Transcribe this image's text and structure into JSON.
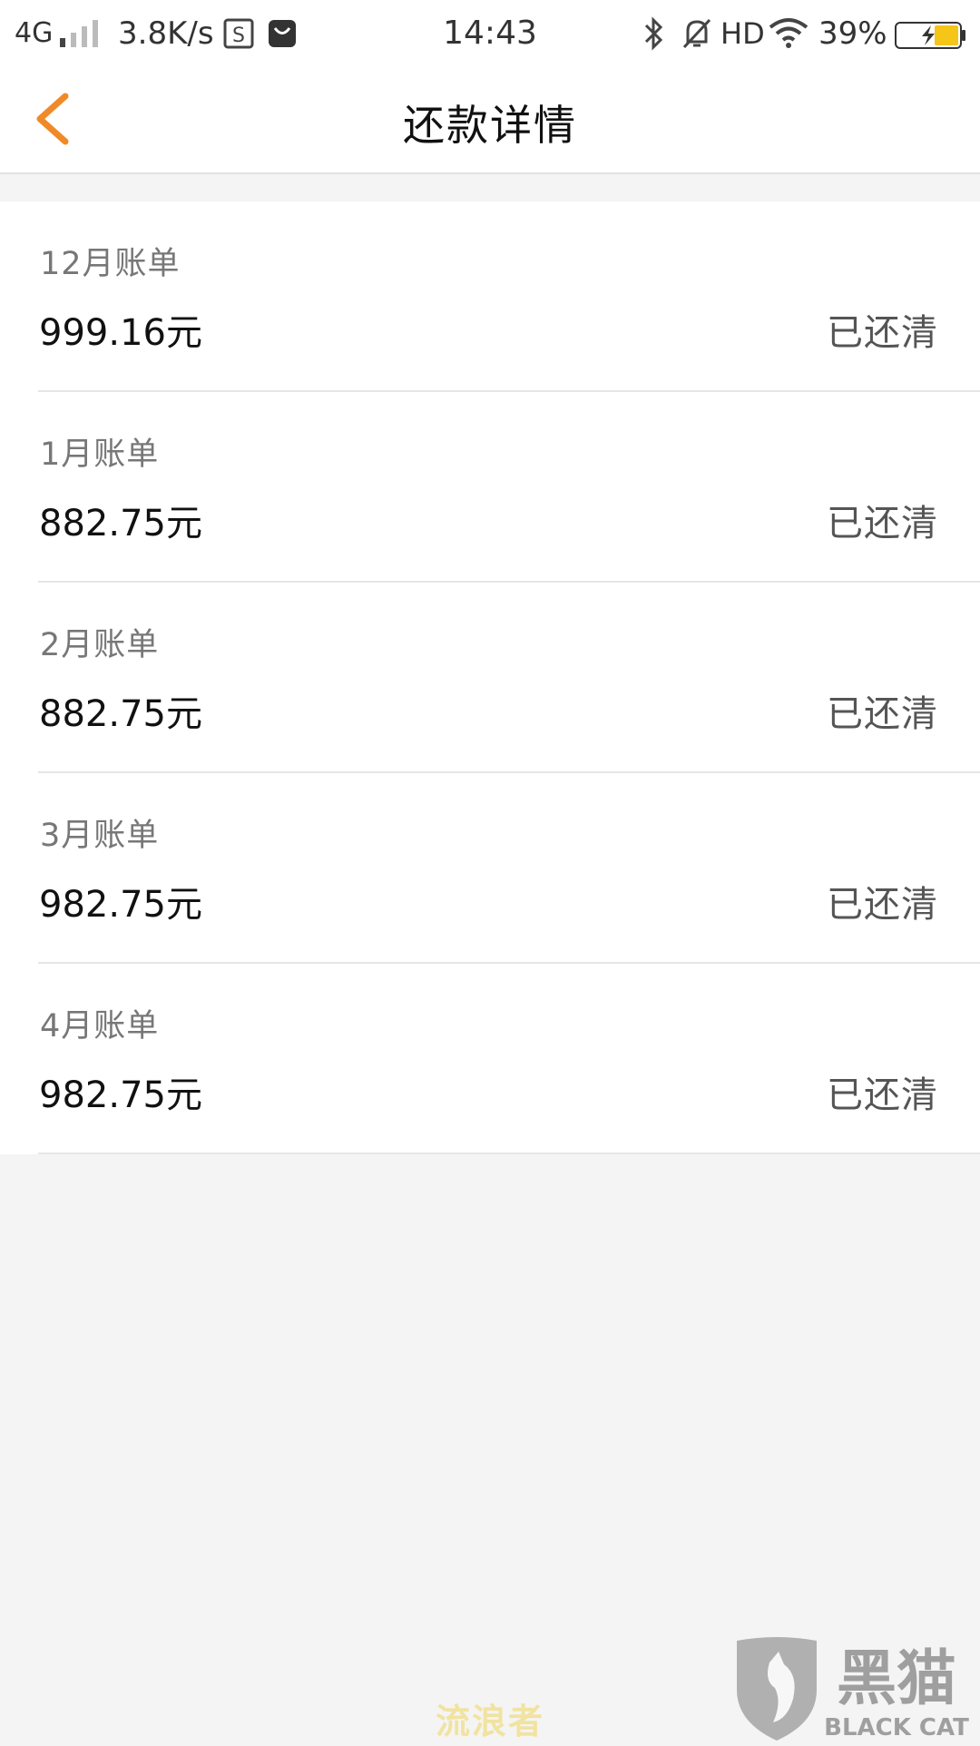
{
  "status_bar": {
    "network": "4G",
    "speed": "3.8K/s",
    "time": "14:43",
    "hd": "HD",
    "battery_percent": "39%",
    "battery_level": 0.39,
    "accent_battery": "#f5c518"
  },
  "nav": {
    "title": "还款详情",
    "accent": "#f08a28"
  },
  "bills": [
    {
      "month": "12月账单",
      "amount": "999.16元",
      "status": "已还清"
    },
    {
      "month": "1月账单",
      "amount": "882.75元",
      "status": "已还清"
    },
    {
      "month": "2月账单",
      "amount": "882.75元",
      "status": "已还清"
    },
    {
      "month": "3月账单",
      "amount": "982.75元",
      "status": "已还清"
    },
    {
      "month": "4月账单",
      "amount": "982.75元",
      "status": "已还清"
    }
  ],
  "watermark": {
    "text": "流浪者",
    "logo_cn": "黑猫",
    "logo_en": "BLACK CAT"
  }
}
